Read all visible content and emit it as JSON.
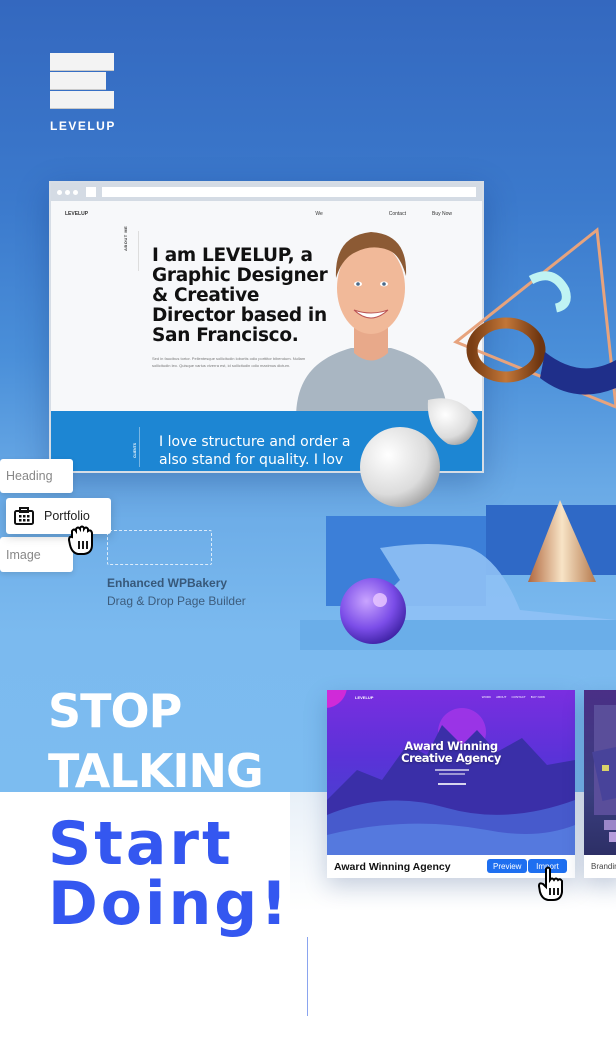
{
  "brand": {
    "logo_text": "LEVELUP"
  },
  "browser_mockup": {
    "site_logo": "LEVELUP",
    "nav_links": [
      "We",
      "Contact",
      "Buy Now"
    ],
    "section_label": "ABOUT ME",
    "headline": "I am LEVELUP, a Graphic Designer & Creative Director based in San Francisco.",
    "body_text": "Sed in faucibus tortor. Pellentesque sollicitudin lobortis odio porttitor bibendum. Nullam sollicitudin leo. Quisque varius viverra est, id sollicitudin odio maximus dictum.",
    "band_label": "CLIENTS",
    "band_text_line1": "I love structure and order a",
    "band_text_line2": "also stand for quality. I lov"
  },
  "page_builder": {
    "elements": [
      {
        "label": "Heading"
      },
      {
        "label": "Portfolio",
        "icon": "portfolio-grid-icon"
      },
      {
        "label": "Image"
      }
    ],
    "feature_title": "Enhanced WPBakery",
    "feature_subtitle": "Drag & Drop Page Builder"
  },
  "slogan": {
    "line1": "STOP",
    "line2": "TALKING",
    "line3": "Start",
    "line4": "Doing!"
  },
  "demos": [
    {
      "name": "Award Winning Agency",
      "thumb_logo": "LEVELUP",
      "thumb_nav": [
        "WORK",
        "ABOUT",
        "CONTACT",
        "BUY NOW"
      ],
      "thumb_title_line1": "Award Winning",
      "thumb_title_line2": "Creative Agency",
      "preview_label": "Preview",
      "import_label": "Import"
    },
    {
      "name": "Branding"
    }
  ],
  "colors": {
    "hero_top": "#3468bf",
    "hero_bottom": "#7cbcf0",
    "accent_blue": "#3457f0",
    "band_blue": "#1d86d3",
    "button_blue": "#1e6ff0"
  }
}
